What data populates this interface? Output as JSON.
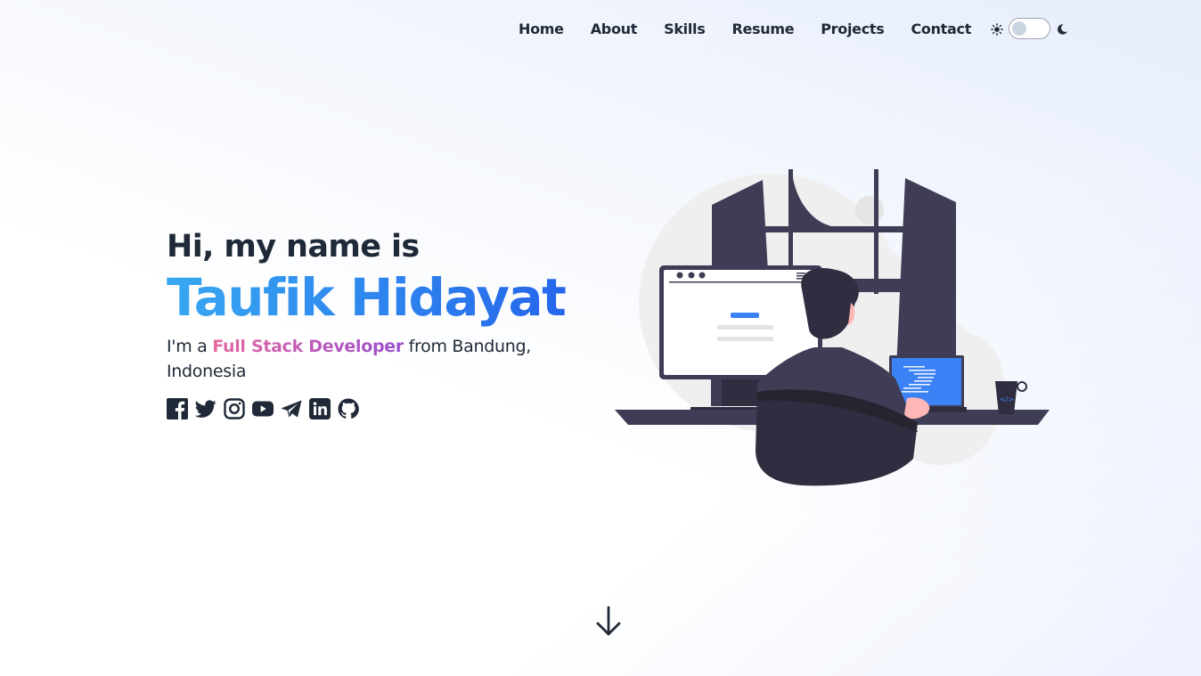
{
  "nav": {
    "items": [
      {
        "label": "Home"
      },
      {
        "label": "About"
      },
      {
        "label": "Skills"
      },
      {
        "label": "Resume"
      },
      {
        "label": "Projects"
      },
      {
        "label": "Contact"
      }
    ],
    "theme_toggle": {
      "light_icon": "sun-icon",
      "dark_icon": "moon-icon",
      "state": "light"
    }
  },
  "hero": {
    "greeting": "Hi, my name is",
    "name": "Taufik Hidayat",
    "tagline_prefix": "I'm a ",
    "role": "Full Stack Developer",
    "tagline_suffix": " from Bandung, Indonesia",
    "socials": [
      {
        "icon": "facebook-icon"
      },
      {
        "icon": "twitter-icon"
      },
      {
        "icon": "instagram-icon"
      },
      {
        "icon": "youtube-icon"
      },
      {
        "icon": "telegram-icon"
      },
      {
        "icon": "linkedin-icon"
      },
      {
        "icon": "github-icon"
      }
    ]
  },
  "illustration": {
    "subject": "developer-at-desk-illustration"
  },
  "scroll": {
    "icon": "arrow-down-icon"
  },
  "colors": {
    "text": "#1f2937",
    "name_gradient_start": "#38a8f2",
    "name_gradient_end": "#2563eb",
    "role_gradient_start": "#e56aa0",
    "role_gradient_end": "#9b4fcf",
    "illustration_dark": "#3f3d56",
    "illustration_accent": "#3b82f6"
  }
}
